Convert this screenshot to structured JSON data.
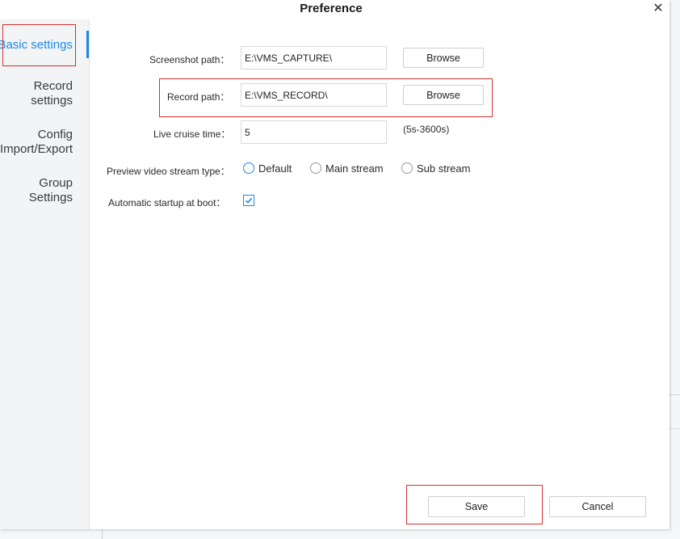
{
  "dialog": {
    "title": "Preference",
    "close_symbol": "✕"
  },
  "sidebar": {
    "items": [
      {
        "label": "Basic settings"
      },
      {
        "label": "Record\nsettings"
      },
      {
        "label": "Config\nImport/Export"
      },
      {
        "label": "Group\nSettings"
      }
    ]
  },
  "form": {
    "screenshot_path": {
      "label": "Screenshot path：",
      "value": "E:\\VMS_CAPTURE\\",
      "browse_label": "Browse"
    },
    "record_path": {
      "label": "Record path：",
      "value": "E:\\VMS_RECORD\\",
      "browse_label": "Browse"
    },
    "live_cruise_time": {
      "label": "Live cruise time：",
      "value": "5",
      "hint": "(5s-3600s)"
    },
    "preview_stream": {
      "label": "Preview video stream type：",
      "options": [
        "Default",
        "Main stream",
        "Sub stream"
      ],
      "selected": "Default"
    },
    "auto_startup": {
      "label": "Automatic startup at boot：",
      "checked": true
    }
  },
  "footer": {
    "save_label": "Save",
    "cancel_label": "Cancel"
  },
  "colors": {
    "accent": "#1e88e5",
    "annotation": "#d32f2f"
  }
}
